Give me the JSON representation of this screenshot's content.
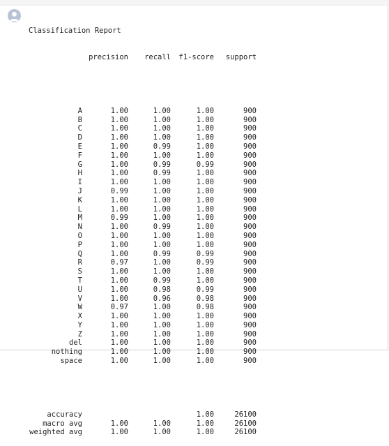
{
  "report": {
    "title": "Classification Report",
    "headers": {
      "precision": "precision",
      "recall": "recall",
      "f1": "f1-score",
      "support": "support"
    },
    "rows": [
      {
        "label": "A",
        "precision": "1.00",
        "recall": "1.00",
        "f1": "1.00",
        "support": "900"
      },
      {
        "label": "B",
        "precision": "1.00",
        "recall": "1.00",
        "f1": "1.00",
        "support": "900"
      },
      {
        "label": "C",
        "precision": "1.00",
        "recall": "1.00",
        "f1": "1.00",
        "support": "900"
      },
      {
        "label": "D",
        "precision": "1.00",
        "recall": "1.00",
        "f1": "1.00",
        "support": "900"
      },
      {
        "label": "E",
        "precision": "1.00",
        "recall": "0.99",
        "f1": "1.00",
        "support": "900"
      },
      {
        "label": "F",
        "precision": "1.00",
        "recall": "1.00",
        "f1": "1.00",
        "support": "900"
      },
      {
        "label": "G",
        "precision": "1.00",
        "recall": "0.99",
        "f1": "0.99",
        "support": "900"
      },
      {
        "label": "H",
        "precision": "1.00",
        "recall": "0.99",
        "f1": "1.00",
        "support": "900"
      },
      {
        "label": "I",
        "precision": "1.00",
        "recall": "1.00",
        "f1": "1.00",
        "support": "900"
      },
      {
        "label": "J",
        "precision": "0.99",
        "recall": "1.00",
        "f1": "1.00",
        "support": "900"
      },
      {
        "label": "K",
        "precision": "1.00",
        "recall": "1.00",
        "f1": "1.00",
        "support": "900"
      },
      {
        "label": "L",
        "precision": "1.00",
        "recall": "1.00",
        "f1": "1.00",
        "support": "900"
      },
      {
        "label": "M",
        "precision": "0.99",
        "recall": "1.00",
        "f1": "1.00",
        "support": "900"
      },
      {
        "label": "N",
        "precision": "1.00",
        "recall": "0.99",
        "f1": "1.00",
        "support": "900"
      },
      {
        "label": "O",
        "precision": "1.00",
        "recall": "1.00",
        "f1": "1.00",
        "support": "900"
      },
      {
        "label": "P",
        "precision": "1.00",
        "recall": "1.00",
        "f1": "1.00",
        "support": "900"
      },
      {
        "label": "Q",
        "precision": "1.00",
        "recall": "0.99",
        "f1": "0.99",
        "support": "900"
      },
      {
        "label": "R",
        "precision": "0.97",
        "recall": "1.00",
        "f1": "0.99",
        "support": "900"
      },
      {
        "label": "S",
        "precision": "1.00",
        "recall": "1.00",
        "f1": "1.00",
        "support": "900"
      },
      {
        "label": "T",
        "precision": "1.00",
        "recall": "0.99",
        "f1": "1.00",
        "support": "900"
      },
      {
        "label": "U",
        "precision": "1.00",
        "recall": "0.98",
        "f1": "0.99",
        "support": "900"
      },
      {
        "label": "V",
        "precision": "1.00",
        "recall": "0.96",
        "f1": "0.98",
        "support": "900"
      },
      {
        "label": "W",
        "precision": "0.97",
        "recall": "1.00",
        "f1": "0.98",
        "support": "900"
      },
      {
        "label": "X",
        "precision": "1.00",
        "recall": "1.00",
        "f1": "1.00",
        "support": "900"
      },
      {
        "label": "Y",
        "precision": "1.00",
        "recall": "1.00",
        "f1": "1.00",
        "support": "900"
      },
      {
        "label": "Z",
        "precision": "1.00",
        "recall": "1.00",
        "f1": "1.00",
        "support": "900"
      },
      {
        "label": "del",
        "precision": "1.00",
        "recall": "1.00",
        "f1": "1.00",
        "support": "900"
      },
      {
        "label": "nothing",
        "precision": "1.00",
        "recall": "1.00",
        "f1": "1.00",
        "support": "900"
      },
      {
        "label": "space",
        "precision": "1.00",
        "recall": "1.00",
        "f1": "1.00",
        "support": "900"
      }
    ],
    "summary": [
      {
        "label": "accuracy",
        "precision": "",
        "recall": "",
        "f1": "1.00",
        "support": "26100"
      },
      {
        "label": "macro avg",
        "precision": "1.00",
        "recall": "1.00",
        "f1": "1.00",
        "support": "26100"
      },
      {
        "label": "weighted avg",
        "precision": "1.00",
        "recall": "1.00",
        "f1": "1.00",
        "support": "26100"
      }
    ]
  },
  "icons": {
    "avatar": "user-avatar-icon"
  },
  "colors": {
    "text": "#1f1f1f",
    "avatar_bg": "#b9c3d6",
    "avatar_fg": "#ffffff"
  }
}
